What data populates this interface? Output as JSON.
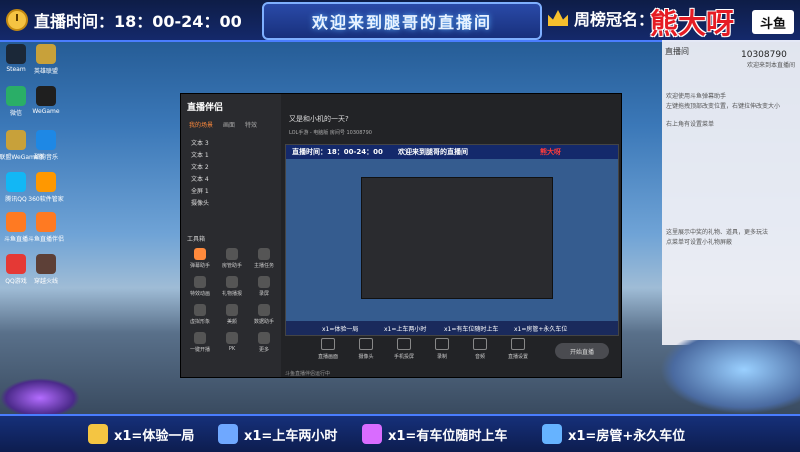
{
  "header": {
    "live_time": "直播时间：18：00-24：00",
    "welcome": "欢迎来到腿哥的直播间",
    "weekly_label": "周榜冠名：",
    "crown_name": "熊大呀",
    "logo_text": "斗鱼"
  },
  "side_panel": {
    "room_label": "直播间",
    "room_id": "10308790",
    "room_sub": "欢迎来到本直播间",
    "notice_1": "欢迎使用斗鱼弹幕助手",
    "notice_2": "左键拖拽顶部改变位置，右键拉伸改变大小",
    "notice_3": "右上角有设置菜单",
    "notice_4": "这里展示中奖的礼物、道具，更多玩法",
    "notice_5": "点菜单可设置小礼物屏蔽"
  },
  "desktop_icons": [
    {
      "label": "Steam",
      "color": "#1b2838"
    },
    {
      "label": "英雄联盟",
      "color": "#c8a13a"
    },
    {
      "label": "微信",
      "color": "#2aae67"
    },
    {
      "label": "WeGame",
      "color": "#1f1f1f"
    },
    {
      "label": "英雄联盟WeGame版",
      "color": "#c8a13a"
    },
    {
      "label": "酷狗音乐",
      "color": "#1e88e5"
    },
    {
      "label": "腾讯QQ",
      "color": "#12b7f5"
    },
    {
      "label": "360软件管家",
      "color": "#ff9800"
    },
    {
      "label": "斗鱼直播",
      "color": "#ff7a22"
    },
    {
      "label": "斗鱼直播伴侣",
      "color": "#ff7a22"
    },
    {
      "label": "QQ游戏",
      "color": "#e53935"
    },
    {
      "label": "穿越火线",
      "color": "#5d4037"
    }
  ],
  "main_window": {
    "logo": "直播伴侣",
    "tabs": [
      "我的场景",
      "画面",
      "特效"
    ],
    "scenes": [
      "文本 3",
      "文本 1",
      "文本 2",
      "文本 4",
      "全屏 1",
      "摄像头"
    ],
    "tools_title": "工具箱",
    "tools": [
      "弹幕助手",
      "房管助手",
      "主播任务",
      "特效动画",
      "礼物播报",
      "录屏",
      "虚拟形象",
      "美颜",
      "数据助手",
      "一键开播",
      "PK",
      "更多"
    ],
    "stream_title": "又是和小机的一天?",
    "stream_meta": "LOL手游 - 电脑版   房间号 10308790",
    "controls": [
      "直播画面",
      "摄像头",
      "手机投屏",
      "录制",
      "音频",
      "直播设置"
    ],
    "start_label": "开始直播",
    "status": "斗鱼直播伴侣运行中"
  },
  "preview": {
    "time": "直播时间：18：00-24：00",
    "welcome": "欢迎来到腿哥的直播间",
    "crown": "熊大呀"
  },
  "gifts": [
    {
      "text": "x1=体验一局",
      "color": "#f4c542"
    },
    {
      "text": "x1=上车两小时",
      "color": "#6fa8ff"
    },
    {
      "text": "x1=有车位随时上车",
      "color": "#d96cff"
    },
    {
      "text": "x1=房管+永久车位",
      "color": "#66b3ff"
    }
  ]
}
